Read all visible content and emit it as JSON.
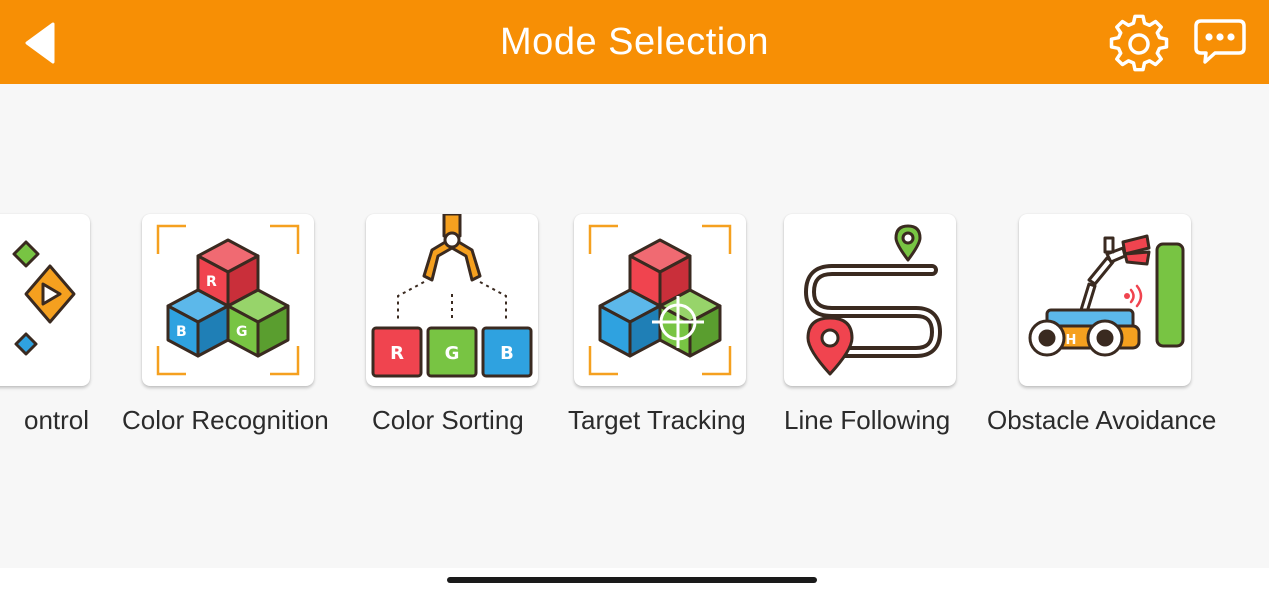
{
  "header": {
    "title": "Mode Selection",
    "background": "#F78F05",
    "back_icon": "back-arrow-icon",
    "settings_icon": "gear-icon",
    "chat_icon": "chat-bubble-icon"
  },
  "modes": [
    {
      "label": "ontrol",
      "icon": "remote-control-icon"
    },
    {
      "label": "Color Recognition",
      "icon": "color-recognition-cubes-icon",
      "cube_letters": [
        "R",
        "B",
        "G"
      ]
    },
    {
      "label": "Color Sorting",
      "icon": "color-sorting-claw-icon",
      "bin_letters": [
        "R",
        "G",
        "B"
      ]
    },
    {
      "label": "Target Tracking",
      "icon": "target-tracking-icon"
    },
    {
      "label": "Line Following",
      "icon": "line-following-path-icon"
    },
    {
      "label": "Obstacle Avoidance",
      "icon": "obstacle-avoidance-robot-icon",
      "robot_letter": "H"
    }
  ],
  "colors": {
    "red": "#F0444F",
    "green": "#78C443",
    "blue": "#2FA2E0",
    "orange": "#F5A01F",
    "outline": "#3a2a20"
  }
}
